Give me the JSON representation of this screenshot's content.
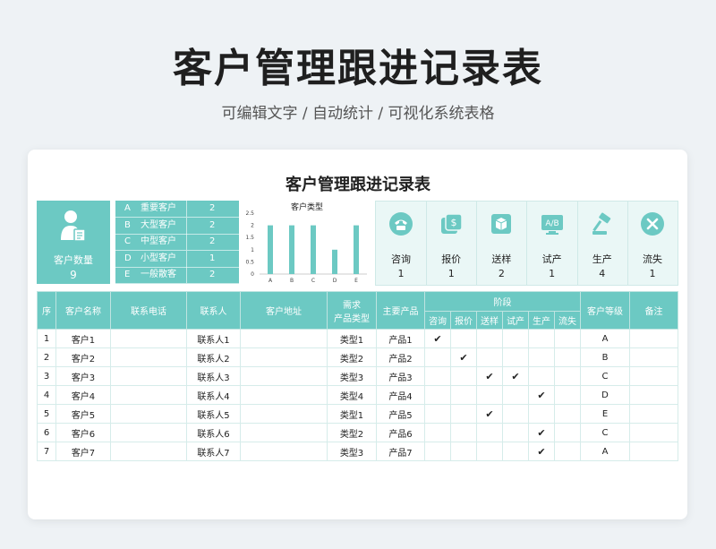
{
  "hero": {
    "title": "客户管理跟进记录表",
    "subtitle": "可编辑文字 / 自动统计 / 可视化系统表格"
  },
  "card_title": "客户管理跟进记录表",
  "kpi": {
    "label": "客户数量",
    "value": "9",
    "icon": "person-card-icon"
  },
  "categories": [
    {
      "key": "A",
      "name": "重要客户",
      "count": "2"
    },
    {
      "key": "B",
      "name": "大型客户",
      "count": "2"
    },
    {
      "key": "C",
      "name": "中型客户",
      "count": "2"
    },
    {
      "key": "D",
      "name": "小型客户",
      "count": "1"
    },
    {
      "key": "E",
      "name": "一般散客",
      "count": "2"
    }
  ],
  "chart_data": {
    "type": "bar",
    "title": "客户类型",
    "categories": [
      "A",
      "B",
      "C",
      "D",
      "E"
    ],
    "values": [
      2,
      2,
      2,
      1,
      2
    ],
    "yticks": [
      "0",
      "0.5",
      "1",
      "1.5",
      "2",
      "2.5"
    ],
    "ylim": [
      0,
      2.5
    ],
    "color": "#6cc9c3"
  },
  "stages": [
    {
      "name": "咨询",
      "count": "1",
      "icon": "telephone-icon"
    },
    {
      "name": "报价",
      "count": "1",
      "icon": "price-tag-icon"
    },
    {
      "name": "送样",
      "count": "2",
      "icon": "package-box-icon"
    },
    {
      "name": "试产",
      "count": "1",
      "icon": "ab-test-icon"
    },
    {
      "name": "生产",
      "count": "4",
      "icon": "hammer-icon"
    },
    {
      "name": "流失",
      "count": "1",
      "icon": "x-circle-icon"
    }
  ],
  "table": {
    "headers": {
      "seq": "序",
      "name": "客户名称",
      "phone": "联系电话",
      "contact": "联系人",
      "address": "客户地址",
      "need_a": "需求",
      "need_b": "产品类型",
      "main": "主要产品",
      "stage": "阶段",
      "level": "客户等级",
      "note": "备注",
      "s1": "咨询",
      "s2": "报价",
      "s3": "送样",
      "s4": "试产",
      "s5": "生产",
      "s6": "流失"
    },
    "check_mark": "✔",
    "rows": [
      {
        "seq": "1",
        "name": "客户1",
        "contact": "联系人1",
        "type": "类型1",
        "product": "产品1",
        "stages": [
          1,
          0,
          0,
          0,
          0,
          0
        ],
        "level": "A"
      },
      {
        "seq": "2",
        "name": "客户2",
        "contact": "联系人2",
        "type": "类型2",
        "product": "产品2",
        "stages": [
          0,
          1,
          0,
          0,
          0,
          0
        ],
        "level": "B"
      },
      {
        "seq": "3",
        "name": "客户3",
        "contact": "联系人3",
        "type": "类型3",
        "product": "产品3",
        "stages": [
          0,
          0,
          1,
          1,
          0,
          0
        ],
        "level": "C"
      },
      {
        "seq": "4",
        "name": "客户4",
        "contact": "联系人4",
        "type": "类型4",
        "product": "产品4",
        "stages": [
          0,
          0,
          0,
          0,
          1,
          0
        ],
        "level": "D"
      },
      {
        "seq": "5",
        "name": "客户5",
        "contact": "联系人5",
        "type": "类型1",
        "product": "产品5",
        "stages": [
          0,
          0,
          1,
          0,
          0,
          0
        ],
        "level": "E"
      },
      {
        "seq": "6",
        "name": "客户6",
        "contact": "联系人6",
        "type": "类型2",
        "product": "产品6",
        "stages": [
          0,
          0,
          0,
          0,
          1,
          0
        ],
        "level": "C"
      },
      {
        "seq": "7",
        "name": "客户7",
        "contact": "联系人7",
        "type": "类型3",
        "product": "产品7",
        "stages": [
          0,
          0,
          0,
          0,
          1,
          0
        ],
        "level": "A"
      }
    ]
  }
}
